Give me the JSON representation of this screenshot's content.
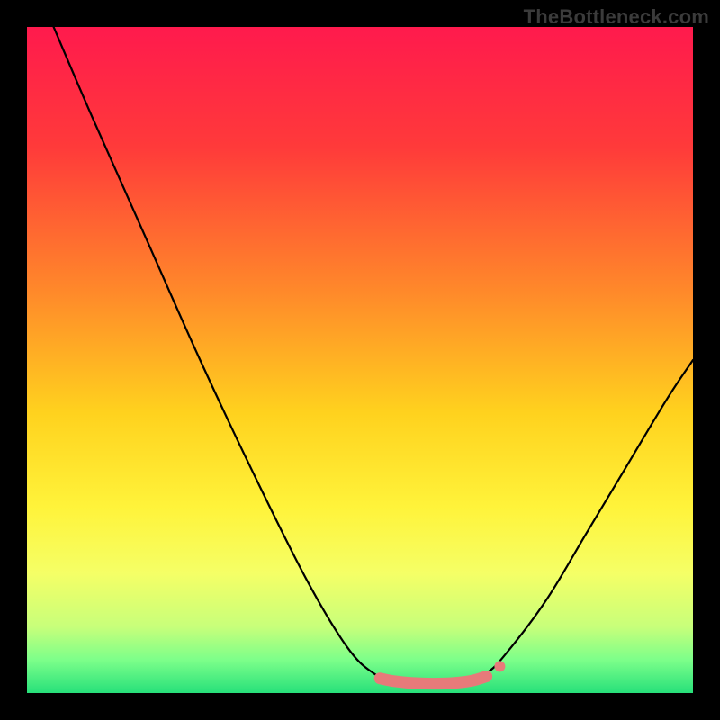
{
  "watermark": "TheBottleneck.com",
  "chart_data": {
    "type": "line",
    "title": "",
    "xlabel": "",
    "ylabel": "",
    "xlim": [
      0,
      100
    ],
    "ylim": [
      0,
      100
    ],
    "gradient_stops": [
      {
        "offset": 0,
        "color": "#ff1a4d"
      },
      {
        "offset": 18,
        "color": "#ff3a3a"
      },
      {
        "offset": 40,
        "color": "#ff8a2a"
      },
      {
        "offset": 58,
        "color": "#ffd21e"
      },
      {
        "offset": 72,
        "color": "#fff33a"
      },
      {
        "offset": 82,
        "color": "#f5ff66"
      },
      {
        "offset": 90,
        "color": "#c8ff7a"
      },
      {
        "offset": 95,
        "color": "#7dff8a"
      },
      {
        "offset": 100,
        "color": "#27e07a"
      }
    ],
    "series": [
      {
        "name": "curve",
        "points": [
          {
            "x": 4,
            "y": 100
          },
          {
            "x": 10,
            "y": 86
          },
          {
            "x": 18,
            "y": 68
          },
          {
            "x": 26,
            "y": 50
          },
          {
            "x": 34,
            "y": 33
          },
          {
            "x": 42,
            "y": 17
          },
          {
            "x": 48,
            "y": 7
          },
          {
            "x": 52,
            "y": 3
          },
          {
            "x": 55,
            "y": 2
          },
          {
            "x": 58,
            "y": 1.5
          },
          {
            "x": 62,
            "y": 1.5
          },
          {
            "x": 66,
            "y": 2
          },
          {
            "x": 69,
            "y": 3
          },
          {
            "x": 72,
            "y": 6
          },
          {
            "x": 78,
            "y": 14
          },
          {
            "x": 84,
            "y": 24
          },
          {
            "x": 90,
            "y": 34
          },
          {
            "x": 96,
            "y": 44
          },
          {
            "x": 100,
            "y": 50
          }
        ]
      }
    ],
    "bottom_highlight": {
      "color": "#e77a7a",
      "width": 13,
      "points": [
        {
          "x": 53,
          "y": 2.2
        },
        {
          "x": 55,
          "y": 1.8
        },
        {
          "x": 58,
          "y": 1.5
        },
        {
          "x": 61,
          "y": 1.4
        },
        {
          "x": 64,
          "y": 1.5
        },
        {
          "x": 67,
          "y": 1.9
        },
        {
          "x": 69,
          "y": 2.5
        }
      ]
    },
    "marker": {
      "x": 71,
      "y": 4,
      "r": 6,
      "color": "#e77a7a"
    }
  }
}
